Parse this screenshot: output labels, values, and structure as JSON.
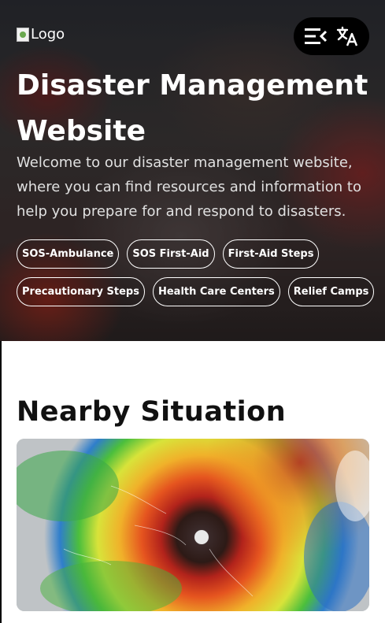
{
  "hero": {
    "logo_alt": "Logo",
    "title": "Disaster Management Website",
    "intro": "Welcome to our disaster management website, where you can find resources and information to help you prepare for and respond to disasters.",
    "controls": [
      {
        "icon": "menu-collapse-icon"
      },
      {
        "icon": "translate-icon"
      }
    ],
    "chips": [
      "SOS-Ambulance",
      "SOS First-Aid",
      "First-Aid Steps",
      "Precautionary Steps",
      "Health Care Centers",
      "Relief Camps"
    ]
  },
  "nearby": {
    "title": "Nearby Situation",
    "image_alt": ""
  },
  "colors": {
    "primary_text": "#111111",
    "hero_text": "#ffffff",
    "controls_bg": "#000000"
  }
}
